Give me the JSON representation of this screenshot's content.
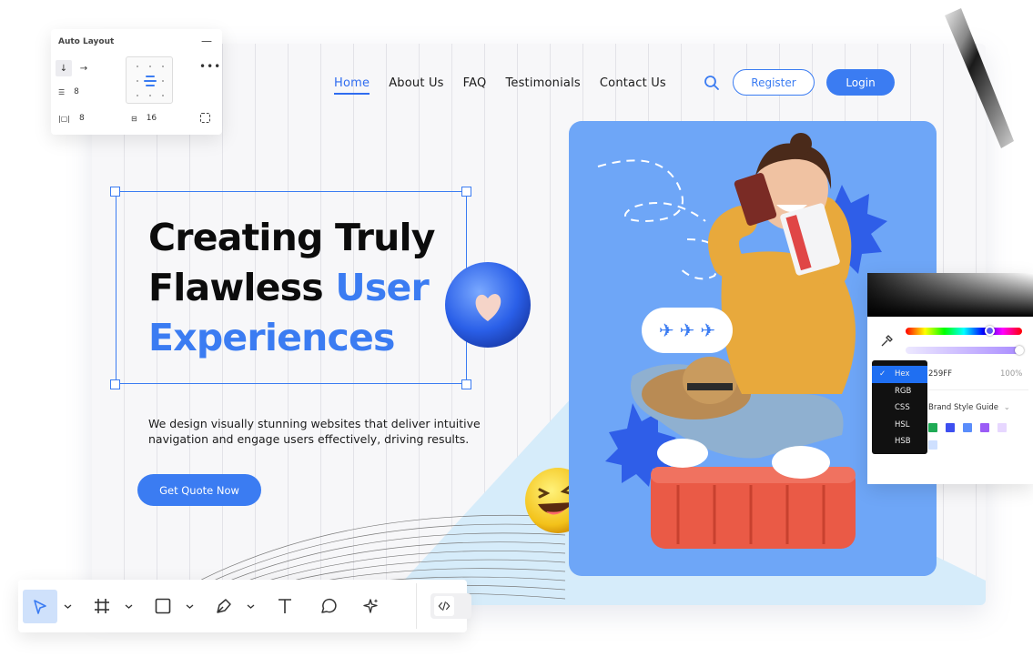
{
  "nav": {
    "items": [
      {
        "label": "Home",
        "active": true
      },
      {
        "label": "About Us",
        "active": false
      },
      {
        "label": "FAQ",
        "active": false
      },
      {
        "label": "Testimonials",
        "active": false
      },
      {
        "label": "Contact Us",
        "active": false
      }
    ],
    "search_icon": "search-icon",
    "register_label": "Register",
    "login_label": "Login"
  },
  "hero": {
    "title_line1": "Creating Truly",
    "title_line2_plain": "Flawless ",
    "title_line2_accent": "User",
    "title_line3_accent": "Experiences",
    "description": "We design visually stunning websites that deliver intuitive navigation and engage users effectively, driving results.",
    "cta_label": "Get Quote Now"
  },
  "auto_layout": {
    "title": "Auto Layout",
    "spacing_vertical": "8",
    "padding_horizontal": "8",
    "gap": "16"
  },
  "color_picker": {
    "hex_value": "259FF",
    "alpha_value": "100%",
    "style_guide_label": "Brand Style Guide",
    "formats": [
      "Hex",
      "RGB",
      "CSS",
      "HSL",
      "HSB"
    ],
    "selected_format": "Hex",
    "swatches": [
      "#1faa55",
      "#3d4ff0",
      "#5a8dfb",
      "#9b5cf6",
      "#e7d7ff"
    ]
  },
  "colors": {
    "accent": "#3b7cf2",
    "photo_card": "#6ea6f7",
    "text_dark": "#0c0c0c"
  },
  "toolbar": {
    "tools": [
      "pointer-icon",
      "frame-icon",
      "rectangle-icon",
      "pen-icon",
      "text-icon",
      "comment-icon",
      "ai-sparkle-icon",
      "code-icon"
    ],
    "active_tool": "pointer-icon"
  }
}
